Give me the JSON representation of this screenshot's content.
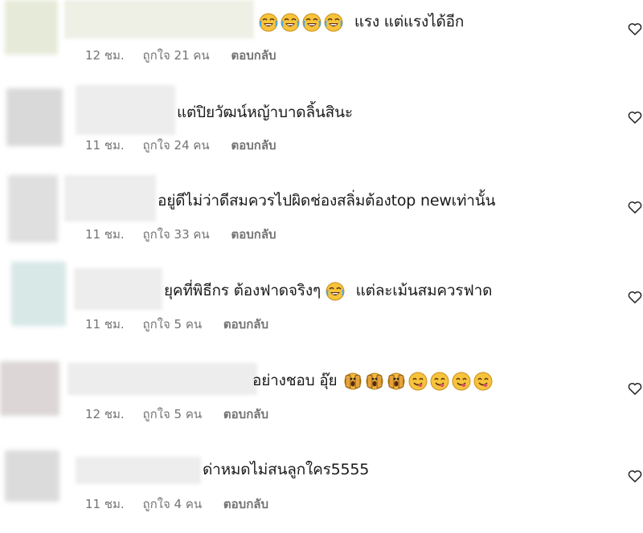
{
  "comments": [
    {
      "text_suffix": "แรง แต่แรงได้อีก",
      "emoji": [
        "face-with-tears-of-joy",
        "face-with-tears-of-joy",
        "face-with-tears-of-joy",
        "face-with-tears-of-joy"
      ],
      "time": "12 ชม.",
      "likes": "ถูกใจ 21 คน",
      "reply": "ตอบกลับ",
      "avatar_color": "#e3e7d4"
    },
    {
      "text": "แต่ปิยวัฒน์หญ้าบาดลิ้นสินะ",
      "time": "11 ชม.",
      "likes": "ถูกใจ 24 คน",
      "reply": "ตอบกลับ",
      "avatar_color": "#dcdcdc"
    },
    {
      "text": "อยู่ดีไม่ว่าดีสมควรไปผิดช่องสลิ่มต้องtop newเท่านั้น",
      "time": "11 ชม.",
      "likes": "ถูกใจ 33 คน",
      "reply": "ตอบกลับ",
      "avatar_color": "#e2e2e2"
    },
    {
      "text_prefix": "ยุคที่พิธีกร ต้องฟาดจริงๆ",
      "text_suffix": "แต่ละเม้นสมควรฟาด",
      "emoji": [
        "face-with-tears-of-joy"
      ],
      "time": "11 ชม.",
      "likes": "ถูกใจ 5 คน",
      "reply": "ตอบกลับ",
      "avatar_color": "#dbe9e8"
    },
    {
      "text_prefix": "อย่างชอบ อุ๊ย",
      "emoji": [
        "face-screaming-in-fear",
        "face-screaming-in-fear",
        "face-screaming-in-fear",
        "yum-face",
        "yum-face",
        "yum-face",
        "yum-face"
      ],
      "time": "12 ชม.",
      "likes": "ถูกใจ 5 คน",
      "reply": "ตอบกลับ",
      "avatar_color": "#e0dcdc"
    },
    {
      "text": "ด่าหมดไม่สนลูกใคร5555",
      "time": "11 ชม.",
      "likes": "ถูกใจ 4 คน",
      "reply": "ตอบกลับ",
      "avatar_color": "#dedede"
    }
  ],
  "icons": {
    "like": "heart-outline-icon"
  }
}
